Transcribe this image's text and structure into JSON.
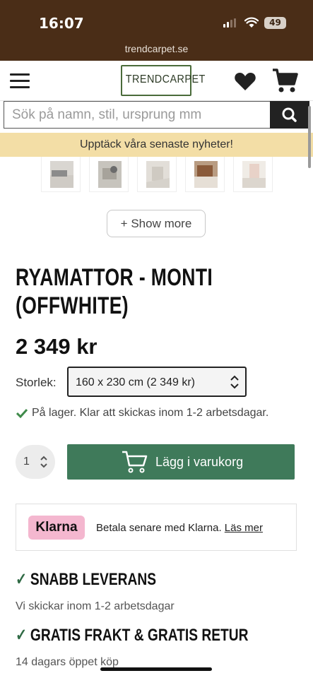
{
  "status_bar": {
    "time": "16:07",
    "battery": "49",
    "url": "trendcarpet.se"
  },
  "header": {
    "logo_text": "TRENDCARPET"
  },
  "search": {
    "placeholder": "Sök på namn, stil, ursprung mm"
  },
  "banner": {
    "text": "Upptäck våra senaste nyheter!"
  },
  "gallery": {
    "show_more_label": "+ Show more"
  },
  "product": {
    "title_line1": "RYAMATTOR - MONTI",
    "title_line2": "(OFFWHITE)",
    "price": "2 349 kr",
    "size_label": "Storlek:",
    "size_value": "160 x 230 cm (2 349 kr)",
    "stock_text": "På lager. Klar att skickas inom 1-2 arbetsdagar.",
    "quantity": "1",
    "add_to_cart_label": "Lägg i varukorg"
  },
  "klarna": {
    "badge": "Klarna",
    "text": "Betala senare med Klarna.",
    "link": "Läs mer"
  },
  "features": [
    {
      "title": "SNABB LEVERANS",
      "subtitle": "Vi skickar inom 1-2 arbetsdagar"
    },
    {
      "title": "GRATIS FRAKT & GRATIS RETUR",
      "subtitle": "14 dagars öppet köp"
    }
  ],
  "colors": {
    "status_bg": "#4a2d17",
    "banner_bg": "#f3dea6",
    "cart_button": "#3f7a5a",
    "klarna_pink": "#f4b7cf",
    "check_green": "#2f6a44"
  }
}
